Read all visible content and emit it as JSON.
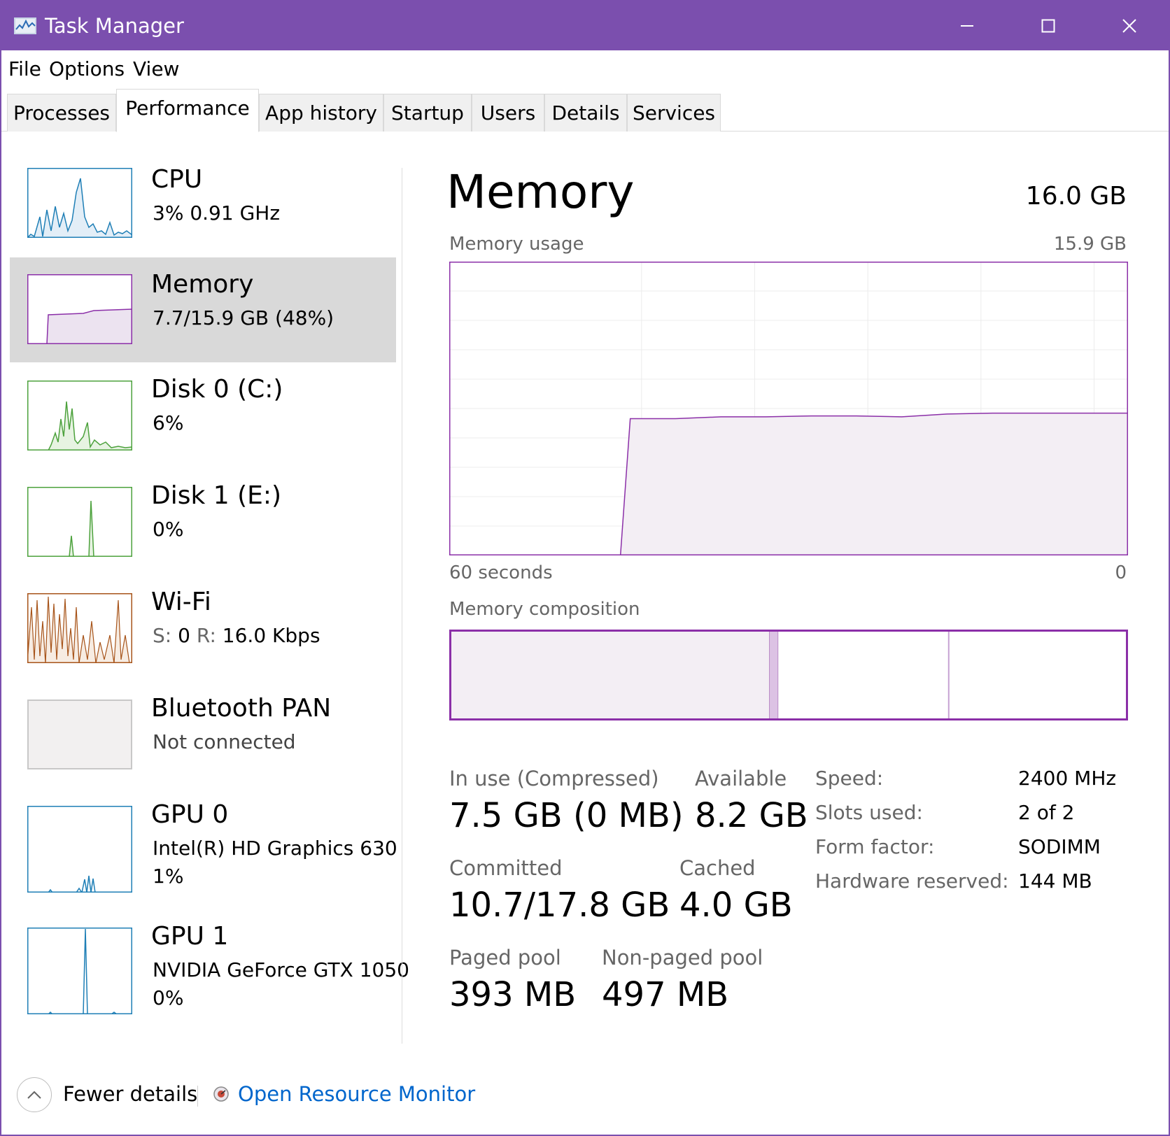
{
  "window": {
    "title": "Task Manager"
  },
  "colors": {
    "accent": "#7b4fae",
    "memory": "#8b2fa8",
    "cpu": "#1f7fb6",
    "disk": "#4da23d",
    "wifi": "#a7541a",
    "link": "#0066cc"
  },
  "menu": [
    "File",
    "Options",
    "View"
  ],
  "tabs": [
    "Processes",
    "Performance",
    "App history",
    "Startup",
    "Users",
    "Details",
    "Services"
  ],
  "active_tab": "Performance",
  "sidebar": {
    "cpu": {
      "name": "CPU",
      "sub": "3%  0.91 GHz"
    },
    "memory": {
      "name": "Memory",
      "sub": "7.7/15.9 GB (48%)"
    },
    "disk0": {
      "name": "Disk 0 (C:)",
      "sub": "6%"
    },
    "disk1": {
      "name": "Disk 1 (E:)",
      "sub": "0%"
    },
    "wifi": {
      "name": "Wi-Fi",
      "send_label": "S:",
      "send": "0",
      "recv_label": "R:",
      "recv": "16.0 Kbps"
    },
    "bt": {
      "name": "Bluetooth PAN",
      "sub": "Not connected"
    },
    "gpu0": {
      "name": "GPU 0",
      "sub1": "Intel(R) HD Graphics 630",
      "sub2": "1%"
    },
    "gpu1": {
      "name": "GPU 1",
      "sub1": "NVIDIA GeForce GTX 1050",
      "sub2": "0%"
    }
  },
  "main": {
    "title": "Memory",
    "total": "16.0 GB",
    "usage_label": "Memory usage",
    "usage_max": "15.9 GB",
    "x_left": "60 seconds",
    "x_right": "0",
    "composition_label": "Memory composition",
    "stats": {
      "in_use_label": "In use (Compressed)",
      "in_use": "7.5 GB (0 MB)",
      "available_label": "Available",
      "available": "8.2 GB",
      "committed_label": "Committed",
      "committed": "10.7/17.8 GB",
      "cached_label": "Cached",
      "cached": "4.0 GB",
      "paged_label": "Paged pool",
      "paged": "393 MB",
      "nonpaged_label": "Non-paged pool",
      "nonpaged": "497 MB"
    },
    "specs": [
      {
        "label": "Speed:",
        "value": "2400 MHz"
      },
      {
        "label": "Slots used:",
        "value": "2 of 2"
      },
      {
        "label": "Form factor:",
        "value": "SODIMM"
      },
      {
        "label": "Hardware reserved:",
        "value": "144 MB"
      }
    ]
  },
  "chart_data": {
    "type": "area",
    "x": [
      60,
      52,
      48,
      44,
      40,
      36,
      32,
      28,
      24,
      20,
      16,
      12,
      8,
      4,
      0
    ],
    "values": [
      null,
      null,
      null,
      7.4,
      7.4,
      7.5,
      7.5,
      7.55,
      7.55,
      7.5,
      7.65,
      7.7,
      7.7,
      7.7,
      7.7
    ],
    "unit": "GB",
    "xlim": [
      60,
      0
    ],
    "ylim": [
      0,
      15.9
    ],
    "grid": true
  },
  "composition": {
    "in_use": 7.5,
    "modified": 0.2,
    "standby": 4.0,
    "free": 4.2,
    "total": 15.9
  },
  "footer": {
    "fewer_details": "Fewer details",
    "resource_monitor": "Open Resource Monitor"
  }
}
